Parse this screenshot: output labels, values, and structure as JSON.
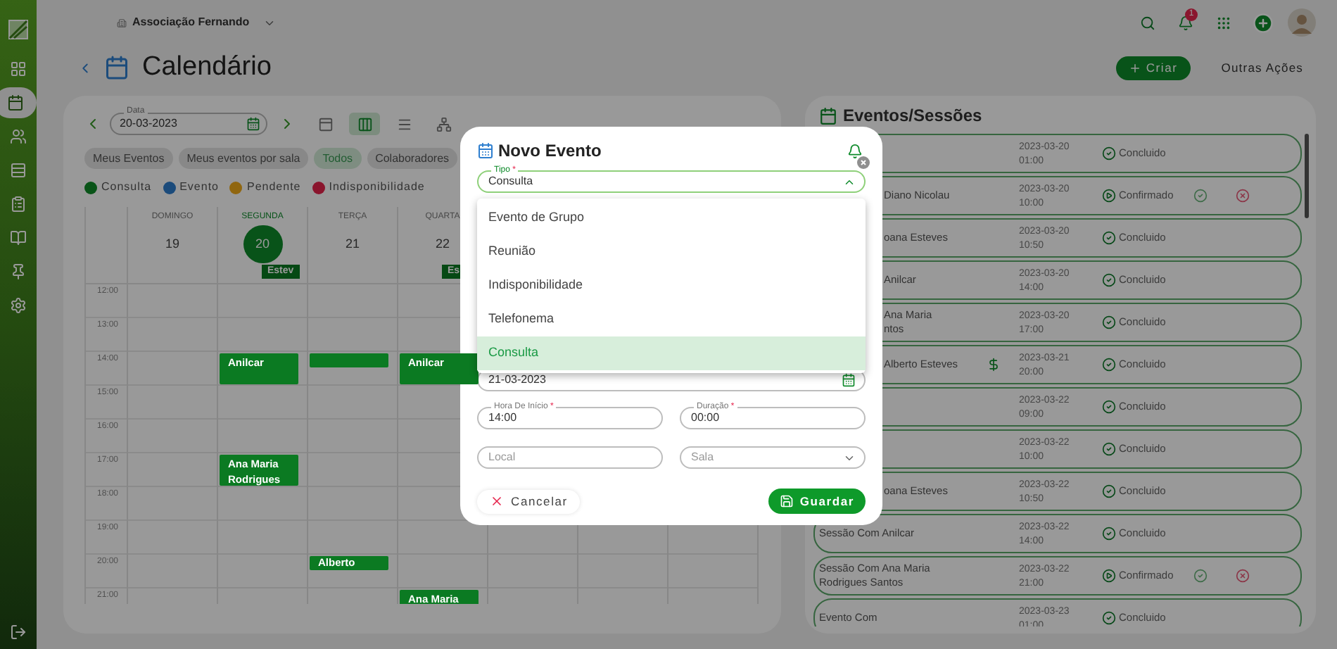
{
  "sidebar": {
    "items": [
      {
        "kind": "dashboard",
        "selected": false
      },
      {
        "kind": "calendar",
        "selected": true
      },
      {
        "kind": "users",
        "selected": false
      },
      {
        "kind": "records",
        "selected": false
      },
      {
        "kind": "billing",
        "selected": false
      },
      {
        "kind": "book",
        "selected": false
      },
      {
        "kind": "pin",
        "selected": false
      },
      {
        "kind": "settings",
        "selected": false
      }
    ]
  },
  "topbar": {
    "organization": "Associação Fernando",
    "notification_count": "1"
  },
  "header": {
    "title": "Calendário",
    "create_button": "Criar",
    "more_button": "Outras Ações"
  },
  "calendar": {
    "date_field": {
      "label": "Data",
      "value": "20-03-2023"
    },
    "views": [
      {
        "kind": "day",
        "selected": false
      },
      {
        "kind": "week",
        "selected": true
      },
      {
        "kind": "list",
        "selected": false
      },
      {
        "kind": "resources",
        "selected": false
      }
    ],
    "filters": [
      {
        "label": "Meus Eventos",
        "selected": false
      },
      {
        "label": "Meus eventos por sala",
        "selected": false
      },
      {
        "label": "Todos",
        "selected": true
      },
      {
        "label": "Colaboradores",
        "selected": false
      }
    ],
    "legend": [
      {
        "label": "Consulta",
        "color": "#095418"
      },
      {
        "label": "Evento",
        "color": "#1b4b7b"
      },
      {
        "label": "Pendente",
        "color": "#90660f"
      },
      {
        "label": "Indisponibilidade",
        "color": "#8a152d"
      }
    ],
    "days": [
      {
        "name": "DOMINGO",
        "number": "19",
        "selected": false
      },
      {
        "name": "SEGUNDA",
        "number": "20",
        "selected": true,
        "all_day": "Estev"
      },
      {
        "name": "TERÇA",
        "number": "21",
        "selected": false
      },
      {
        "name": "QUARTA",
        "number": "22",
        "selected": false,
        "all_day": "Es"
      }
    ],
    "hours": [
      {
        "label": "12:00"
      },
      {
        "label": "13:00"
      },
      {
        "label": "14:00",
        "cells": [
          {
            "kind": "empty"
          },
          {
            "kind": "hour_event",
            "label": "Anilcar"
          },
          {
            "kind": "short_event"
          },
          {
            "kind": "hour_event",
            "label": "Anilcar"
          }
        ]
      },
      {
        "label": "15:00"
      },
      {
        "label": "16:00"
      },
      {
        "label": "17:00",
        "cells": [
          {
            "kind": "empty"
          },
          {
            "kind": "hour_event",
            "label": "Ana Maria Rodrigues"
          }
        ]
      },
      {
        "label": "18:00"
      },
      {
        "label": "19:00"
      },
      {
        "label": "20:00",
        "cells": [
          {
            "kind": "empty"
          },
          {
            "kind": "empty"
          },
          {
            "kind": "short_event",
            "label": "Alberto"
          }
        ]
      },
      {
        "label": "21:00",
        "cells": [
          {
            "kind": "empty"
          },
          {
            "kind": "empty"
          },
          {
            "kind": "empty"
          },
          {
            "kind": "hour_event",
            "label": "Ana Maria"
          }
        ]
      }
    ]
  },
  "events": {
    "title": "Eventos/Sessões",
    "rows": [
      {
        "date": "2023-03-20",
        "time": "01:00",
        "kind": "concluded",
        "status": "Concluido",
        "paid": false
      },
      {
        "name": "Diano Nicolau",
        "date": "2023-03-20",
        "time": "10:00",
        "kind": "confirmed",
        "status": "Confirmado",
        "paid": false
      },
      {
        "name": "oana Esteves",
        "date": "2023-03-20",
        "time": "10:50",
        "kind": "concluded",
        "status": "Concluido",
        "paid": false
      },
      {
        "name": "Anilcar",
        "date": "2023-03-20",
        "time": "14:00",
        "kind": "concluded",
        "status": "Concluido",
        "paid": false
      },
      {
        "name": "Ana Maria\nntos",
        "date": "2023-03-20",
        "time": "17:00",
        "kind": "concluded",
        "status": "Concluido",
        "paid": false
      },
      {
        "name": "Alberto Esteves",
        "date": "2023-03-21",
        "time": "20:00",
        "kind": "concluded",
        "status": "Concluido",
        "paid": true
      },
      {
        "date": "2023-03-22",
        "time": "09:00",
        "kind": "concluded",
        "status": "Concluido",
        "paid": false
      },
      {
        "date": "2023-03-22",
        "time": "10:00",
        "kind": "concluded",
        "status": "Concluido",
        "paid": false
      },
      {
        "name": "oana Esteves",
        "date": "2023-03-22",
        "time": "10:50",
        "kind": "concluded",
        "status": "Concluido",
        "paid": false
      },
      {
        "name": "Sessão Com Anilcar",
        "date": "2023-03-22",
        "time": "14:00",
        "kind": "concluded",
        "status": "Concluido",
        "paid": false
      },
      {
        "name": "Sessão Com Ana Maria\nRodrigues Santos",
        "date": "2023-03-22",
        "time": "21:00",
        "kind": "confirmed",
        "status": "Confirmado",
        "paid": false
      },
      {
        "name": "Evento Com",
        "date": "2023-03-23",
        "time": "01:00",
        "kind": "concluded",
        "status": "Concluido",
        "paid": false
      }
    ]
  },
  "dialog": {
    "title": "Novo Evento",
    "type_field": {
      "label": "Tipo",
      "mark": "*",
      "value": "Consulta",
      "expanded": true
    },
    "options": [
      {
        "label": "Evento de Grupo",
        "selected": false
      },
      {
        "label": "Reunião",
        "selected": false
      },
      {
        "label": "Indisponibilidade",
        "selected": false
      },
      {
        "label": "Telefonema",
        "selected": false
      },
      {
        "label": "Consulta",
        "selected": true
      }
    ],
    "date_field": {
      "value": "21-03-2023"
    },
    "start_field": {
      "label": "Hora De Início",
      "mark": "*",
      "value": "14:00"
    },
    "duration_field": {
      "label": "Duração",
      "mark": "*",
      "value": "00:00"
    },
    "location_field": {
      "placeholder": "Local"
    },
    "room_field": {
      "placeholder": "Sala"
    },
    "cancel_button": "Cancelar",
    "save_button": "Guardar"
  }
}
